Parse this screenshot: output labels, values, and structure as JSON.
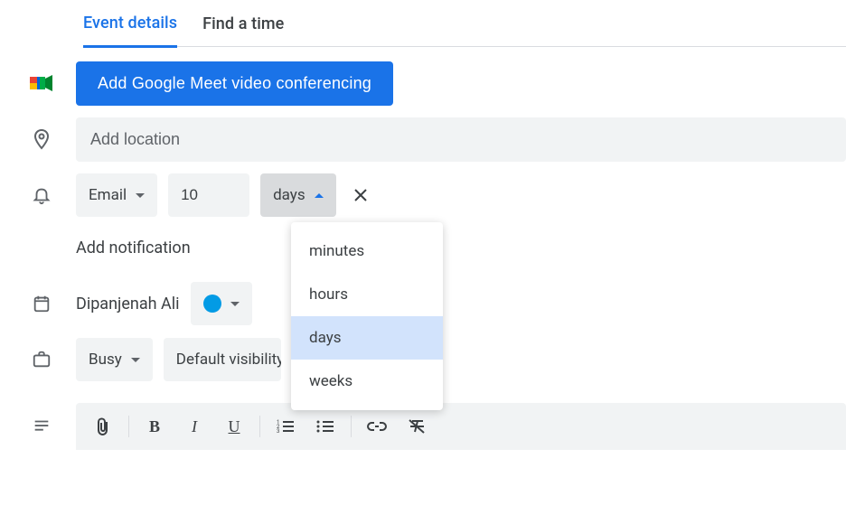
{
  "tabs": {
    "event_details": "Event details",
    "find_a_time": "Find a time"
  },
  "meet_button": "Add Google Meet video conferencing",
  "location": {
    "placeholder": "Add location"
  },
  "notification": {
    "method": "Email",
    "value": "10",
    "unit": "days",
    "unit_options": {
      "minutes": "minutes",
      "hours": "hours",
      "days": "days",
      "weeks": "weeks"
    },
    "add_label": "Add notification"
  },
  "calendar": {
    "owner": "Dipanjenah Ali",
    "color": "#039be5"
  },
  "visibility": {
    "busy": "Busy",
    "default": "Default visibility"
  }
}
